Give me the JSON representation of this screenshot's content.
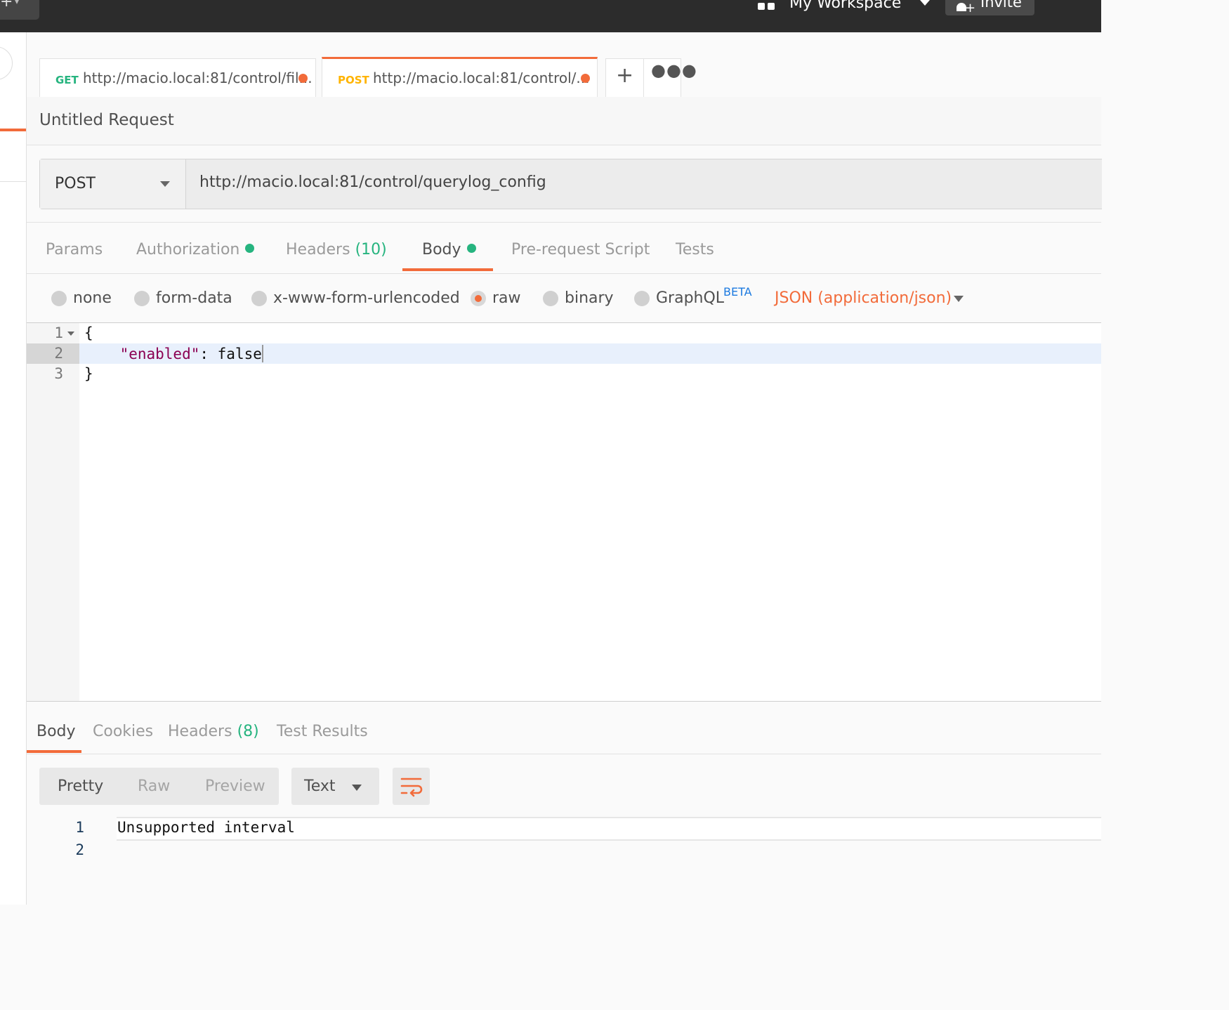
{
  "topbar": {
    "new_icon": "plus-icon",
    "workspace_icon": "workspace-grid-icon",
    "workspace_label": "My Workspace",
    "invite_icon": "add-user-icon",
    "invite_label": "Invite"
  },
  "tabs": [
    {
      "method": "GET",
      "method_color": "#26b47f",
      "url": "http://macio.local:81/control/fil...",
      "unsaved": true,
      "active": false
    },
    {
      "method": "POST",
      "method_color": "#ffb400",
      "url": "http://macio.local:81/control/...",
      "unsaved": true,
      "active": true
    }
  ],
  "tab_actions": {
    "add_icon": "plus-icon",
    "more_icon": "ellipsis-icon"
  },
  "request": {
    "name": "Untitled Request",
    "method": "POST",
    "url": "http://macio.local:81/control/querylog_config"
  },
  "request_tabs": {
    "params": "Params",
    "authorization": "Authorization",
    "headers": "Headers",
    "headers_count": "(10)",
    "body": "Body",
    "prerequest": "Pre-request Script",
    "tests": "Tests",
    "active": "Body"
  },
  "body_types": {
    "none": "none",
    "form_data": "form-data",
    "urlencoded": "x-www-form-urlencoded",
    "raw": "raw",
    "binary": "binary",
    "graphql": "GraphQL",
    "beta": "BETA",
    "selected": "raw",
    "language": "JSON (application/json)"
  },
  "editor": {
    "lines": [
      {
        "num": "1",
        "text": "{"
      },
      {
        "num": "2",
        "key": "\"enabled\"",
        "rest": ": false"
      },
      {
        "num": "3",
        "text": "}"
      }
    ]
  },
  "response": {
    "tabs": {
      "body": "Body",
      "cookies": "Cookies",
      "headers": "Headers",
      "headers_count": "(8)",
      "test_results": "Test Results"
    },
    "views": {
      "pretty": "Pretty",
      "raw": "Raw",
      "preview": "Preview"
    },
    "format": "Text",
    "wrap_icon": "wrap-lines-icon",
    "lines": [
      {
        "num": "1",
        "text": "Unsupported interval"
      },
      {
        "num": "2",
        "text": ""
      }
    ]
  },
  "colors": {
    "accent": "#f26b3a",
    "green": "#26b47f",
    "beta_blue": "#1c7ae0",
    "json_key": "#8b0052"
  }
}
